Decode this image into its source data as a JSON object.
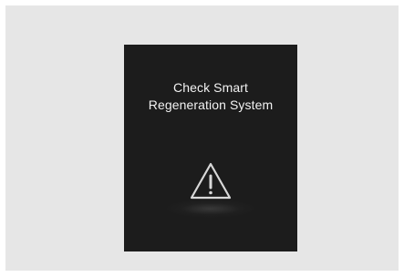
{
  "message": {
    "line1": "Check Smart",
    "line2": "Regeneration System"
  },
  "icon": "warning-triangle-icon",
  "colors": {
    "page_background": "#e6e6e6",
    "screen_background": "#1c1c1c",
    "text": "#f2f2f2",
    "icon_stroke": "#d8d8d8"
  }
}
